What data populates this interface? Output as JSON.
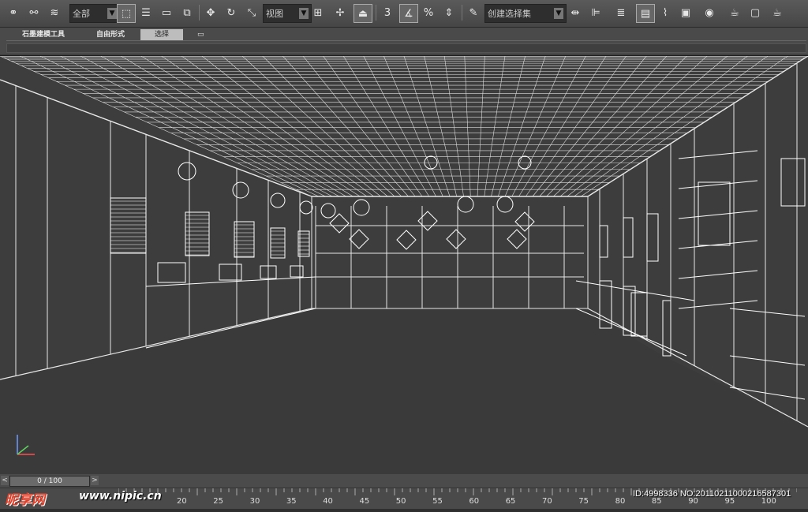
{
  "toolbar": {
    "selection_filter": "全部",
    "coord_system": "视图",
    "named_selection": "创建选择集",
    "snap_label": "3",
    "dropdown_arrow": "▼",
    "icons": [
      "link-icon",
      "unlink-icon",
      "bind-spacewarp-icon",
      "select-icon",
      "select-by-name-icon",
      "rect-region-icon",
      "window-crossing-icon",
      "move-icon",
      "rotate-icon",
      "scale-icon",
      "pivot-icon",
      "manipulate-icon",
      "snap-icon",
      "angle-snap-icon",
      "percent-snap-icon",
      "spinner-snap-icon",
      "edit-named-sel-icon",
      "mirror-icon",
      "align-icon",
      "layer-icon",
      "scene-explorer-icon",
      "curve-editor-icon",
      "schematic-icon",
      "material-editor-icon",
      "render-setup-icon",
      "rendered-frame-icon",
      "render-icon"
    ]
  },
  "ribbon": {
    "tabs": [
      {
        "label": "石墨建模工具",
        "active": false
      },
      {
        "label": "自由形式",
        "active": false
      },
      {
        "label": "选择",
        "active": true
      },
      {
        "label": "▭",
        "active": false
      }
    ]
  },
  "timeline": {
    "frame_label": "0 / 100",
    "prev": "<",
    "next": ">"
  },
  "ruler": {
    "labels": [
      "20",
      "25",
      "30",
      "35",
      "40",
      "45",
      "50",
      "55",
      "60",
      "65",
      "70",
      "75",
      "80",
      "85",
      "90",
      "95",
      "100"
    ]
  },
  "watermark": {
    "logo": "昵享网",
    "url": "www.nipic.cn",
    "id": "ID:4998336 NO:20110211000216587301"
  }
}
